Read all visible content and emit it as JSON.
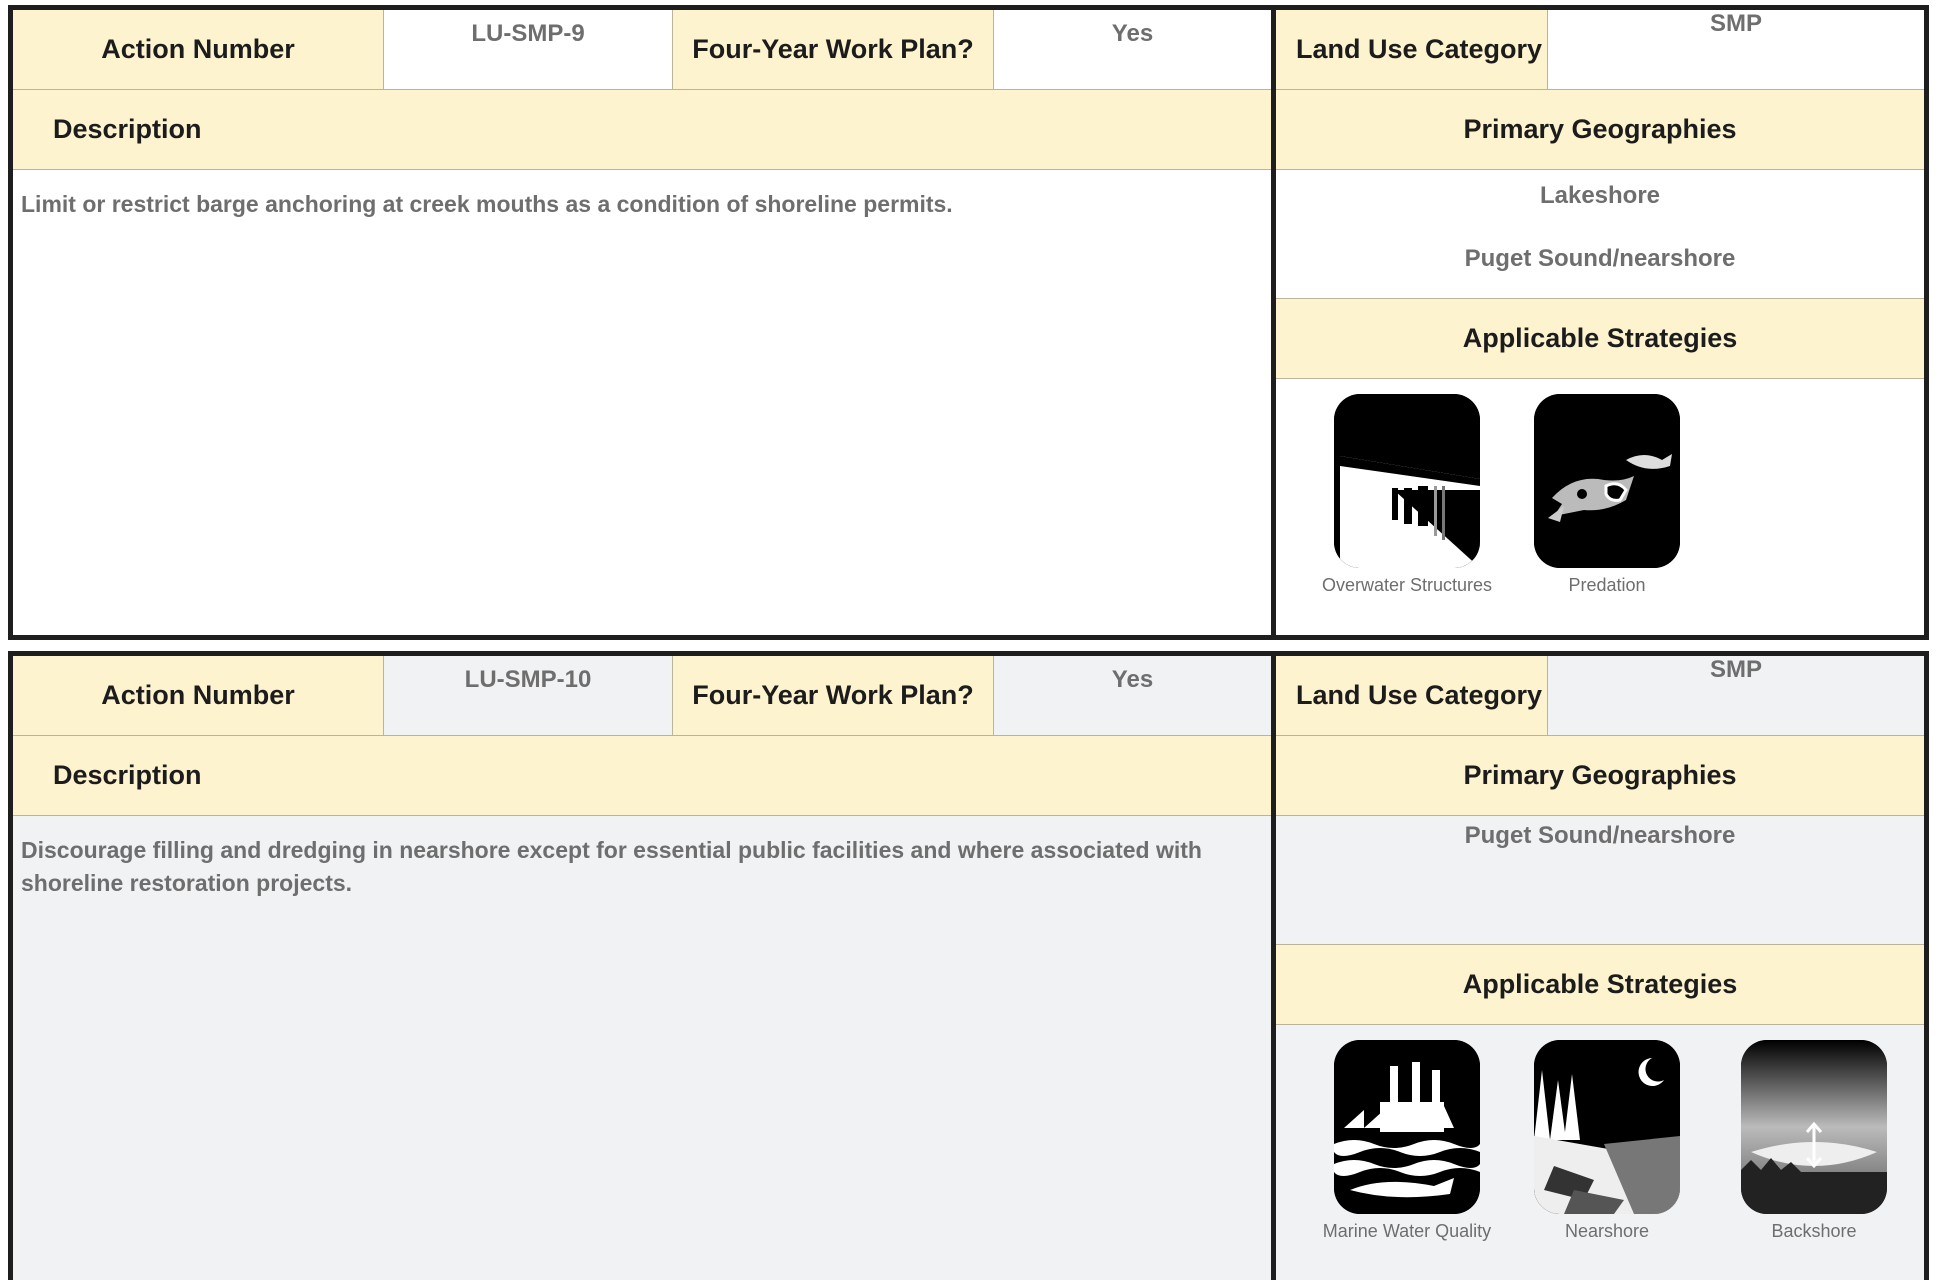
{
  "actions": [
    {
      "action_number_label": "Action Number",
      "action_number": "LU-SMP-9",
      "work_plan_label": "Four-Year Work Plan?",
      "work_plan": "Yes",
      "land_use_label": "Land Use Category",
      "land_use": "SMP",
      "description_label": "Description",
      "description": "Limit or restrict barge anchoring at creek mouths as a condition of shoreline permits.",
      "geographies_label": "Primary Geographies",
      "geographies": [
        "Lakeshore",
        "Puget Sound/nearshore"
      ],
      "strategies_label": "Applicable Strategies",
      "strategies": [
        {
          "name": "Overwater Structures",
          "icon": "overwater-structures-icon"
        },
        {
          "name": "Predation",
          "icon": "predation-icon"
        }
      ]
    },
    {
      "action_number_label": "Action Number",
      "action_number": "LU-SMP-10",
      "work_plan_label": "Four-Year Work Plan?",
      "work_plan": "Yes",
      "land_use_label": "Land Use Category",
      "land_use": "SMP",
      "description_label": "Description",
      "description": "Discourage filling and dredging in nearshore except for essential public facilities and where associated with shoreline restoration projects.",
      "geographies_label": "Primary Geographies",
      "geographies": [
        "Puget Sound/nearshore"
      ],
      "strategies_label": "Applicable Strategies",
      "strategies": [
        {
          "name": "Marine Water Quality",
          "icon": "marine-water-quality-icon"
        },
        {
          "name": "Nearshore",
          "icon": "nearshore-icon"
        },
        {
          "name": "Backshore",
          "icon": "backshore-icon"
        }
      ]
    }
  ],
  "colors": {
    "header_fill": "#fdf3cf",
    "border": "#1e1e1e",
    "value_text": "#6e6e6e",
    "label_text": "#1c1c1c"
  }
}
